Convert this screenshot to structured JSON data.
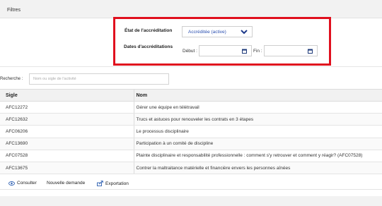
{
  "filters": {
    "header_label": "Filtres",
    "accreditation_status_label": "État de l'accréditation",
    "accreditation_status_value": "Accréditée (active)",
    "accreditation_dates_label": "Dates d'accréditations",
    "start_label": "Début :",
    "end_label": "Fin :",
    "start_value": "",
    "end_value": ""
  },
  "search": {
    "label": "Recherche :",
    "placeholder": "Nom ou sigle de l'activité",
    "value": ""
  },
  "table": {
    "columns": [
      "Sigle",
      "Nom"
    ],
    "rows": [
      {
        "sigle": "AFC12272",
        "nom": "Gérer une équipe en télétravail"
      },
      {
        "sigle": "AFC12632",
        "nom": "Trucs et astuces pour renouveler les contrats en 3 étapes"
      },
      {
        "sigle": "AFC06206",
        "nom": "Le processus disciplinaire"
      },
      {
        "sigle": "AFC13690",
        "nom": "Participation à un comité de discipline"
      },
      {
        "sigle": "AFC07528",
        "nom": "Plainte disciplinaire et responsabilité professionnelle : comment s'y retrouver et comment y réagir? (AFC07528)"
      },
      {
        "sigle": "AFC13675",
        "nom": "Contrer la maltraitance matérielle et financière envers les personnes aînées"
      }
    ]
  },
  "actions": {
    "consult_label": "Consulter",
    "new_request_label": "Nouvelle demande",
    "export_label": "Exportation"
  },
  "colors": {
    "highlight_border": "#e0101e",
    "select_text": "#2a4fb0",
    "chevron": "#1e3a8a",
    "calendar_icon": "#1f3b7a"
  }
}
